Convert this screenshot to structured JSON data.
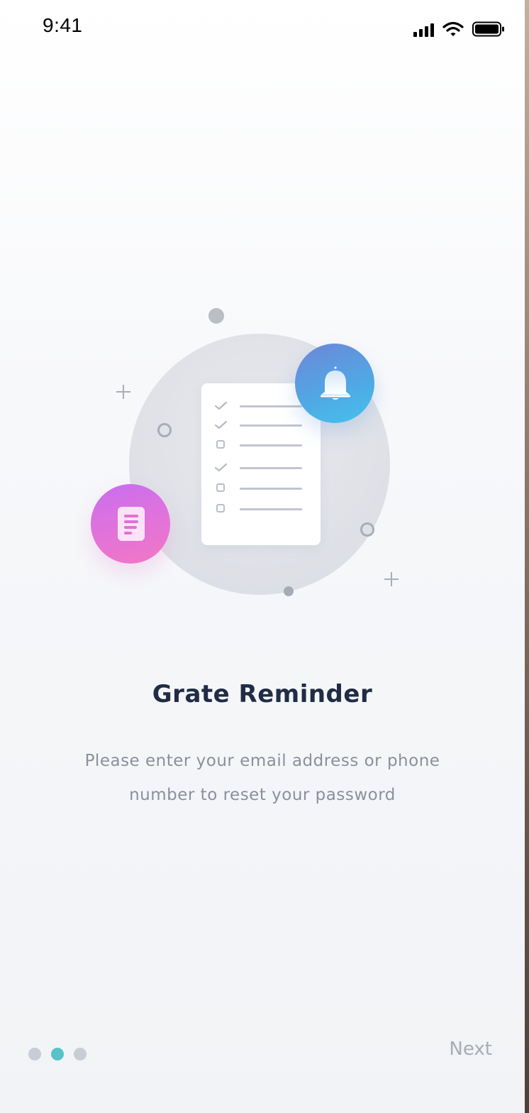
{
  "status_bar": {
    "time": "9:41",
    "icons": [
      "cellular-signal-icon",
      "wifi-icon",
      "battery-icon"
    ]
  },
  "illustration": {
    "icons": [
      "checklist-icon",
      "bell-icon",
      "document-icon"
    ],
    "checklist_items": [
      {
        "state": "checked"
      },
      {
        "state": "checked"
      },
      {
        "state": "unchecked"
      },
      {
        "state": "checked"
      },
      {
        "state": "unchecked"
      },
      {
        "state": "unchecked"
      }
    ]
  },
  "onboarding": {
    "title": "Grate Reminder",
    "description_line1": "Please enter your email address or phone",
    "description_line2": "number to reset your password"
  },
  "pager": {
    "total_pages": 3,
    "active_page": 2
  },
  "next_label": "Next",
  "colors": {
    "title": "#212c45",
    "text_muted": "#8a909c",
    "accent_active_dot": "#56c3c9",
    "bell_gradient": [
      "#6e86d8",
      "#44c3ec"
    ],
    "doc_gradient": [
      "#c86ef0",
      "#f377c4"
    ]
  }
}
